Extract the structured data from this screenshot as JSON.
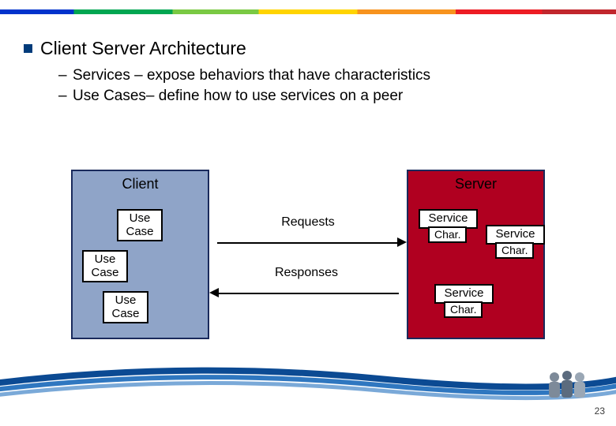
{
  "heading": "Client Server Architecture",
  "bullets": [
    "Services – expose behaviors that have characteristics",
    "Use Cases– define how to use services on a peer"
  ],
  "diagram": {
    "client_label": "Client",
    "server_label": "Server",
    "use_case_label": "Use Case",
    "service_label": "Service",
    "char_label": "Char.",
    "requests_label": "Requests",
    "responses_label": "Responses"
  },
  "page_number": "23"
}
